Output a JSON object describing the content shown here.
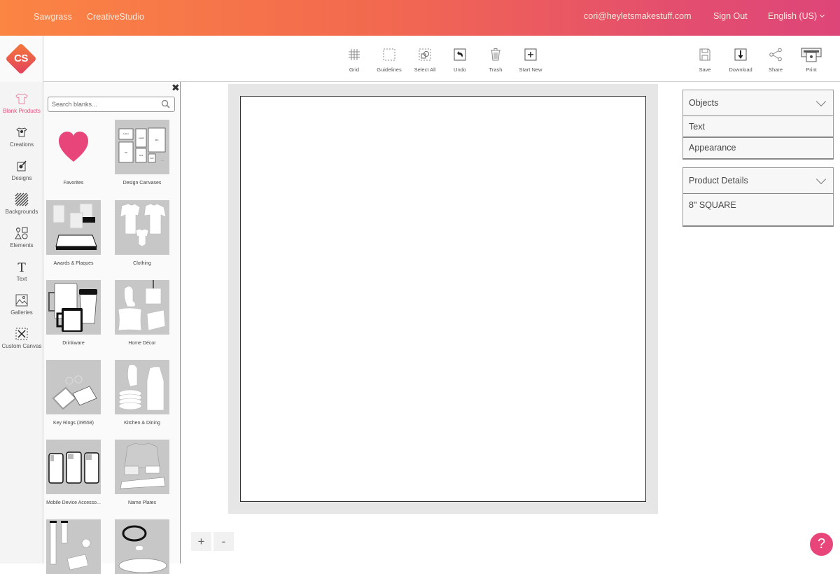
{
  "header": {
    "brand": "Sawgrass",
    "app_name": "CreativeStudio",
    "user_email": "cori@heyletsmakestuff.com",
    "sign_out": "Sign Out",
    "language": "English (US)"
  },
  "logo": {
    "text": "CS"
  },
  "toolbar": {
    "left_tools": [
      {
        "label": "Grid",
        "icon": "grid-icon"
      },
      {
        "label": "Guidelines",
        "icon": "guidelines-icon"
      },
      {
        "label": "Select All",
        "icon": "select-all-icon"
      },
      {
        "label": "Undo",
        "icon": "undo-icon"
      },
      {
        "label": "Trash",
        "icon": "trash-icon"
      },
      {
        "label": "Start New",
        "icon": "plus-icon"
      }
    ],
    "right_tools": [
      {
        "label": "Save",
        "icon": "save-icon"
      },
      {
        "label": "Download",
        "icon": "download-icon"
      },
      {
        "label": "Share",
        "icon": "share-icon"
      },
      {
        "label": "Print",
        "icon": "print-icon"
      }
    ]
  },
  "sidebar": {
    "items": [
      {
        "label": "Blank Products",
        "icon": "tshirt-icon",
        "active": true
      },
      {
        "label": "Creations",
        "icon": "creations-icon"
      },
      {
        "label": "Designs",
        "icon": "designs-icon"
      },
      {
        "label": "Backgrounds",
        "icon": "backgrounds-icon"
      },
      {
        "label": "Elements",
        "icon": "elements-icon"
      },
      {
        "label": "Text",
        "icon": "text-icon"
      },
      {
        "label": "Galleries",
        "icon": "galleries-icon"
      },
      {
        "label": "Custom Canvas",
        "icon": "custom-canvas-icon"
      }
    ]
  },
  "blanks": {
    "search_placeholder": "Search blanks...",
    "categories": [
      {
        "label": "Favorites"
      },
      {
        "label": "Design Canvases"
      },
      {
        "label": "Awards & Plaques"
      },
      {
        "label": "Clothing"
      },
      {
        "label": "Drinkware"
      },
      {
        "label": "Home Décor"
      },
      {
        "label": "Key Rings (39558)"
      },
      {
        "label": "Kitchen & Dining"
      },
      {
        "label": "Mobile Device Accesso..."
      },
      {
        "label": "Name Plates"
      },
      {
        "label": ""
      },
      {
        "label": ""
      }
    ],
    "canvas_sizes": [
      "Letter",
      "Legal",
      "4Fx",
      "5X",
      "4X4",
      "3x3"
    ]
  },
  "zoom": {
    "in": "+",
    "out": "-"
  },
  "right_panel": {
    "objects": {
      "title": "Objects",
      "rows": [
        "Text",
        "Appearance"
      ]
    },
    "product_details": {
      "title": "Product Details",
      "value": "8\" SQUARE"
    }
  },
  "help": {
    "label": "?"
  },
  "colors": {
    "accent": "#e8457a",
    "gradient_start": "#fb8543",
    "gradient_end": "#dd4679"
  }
}
